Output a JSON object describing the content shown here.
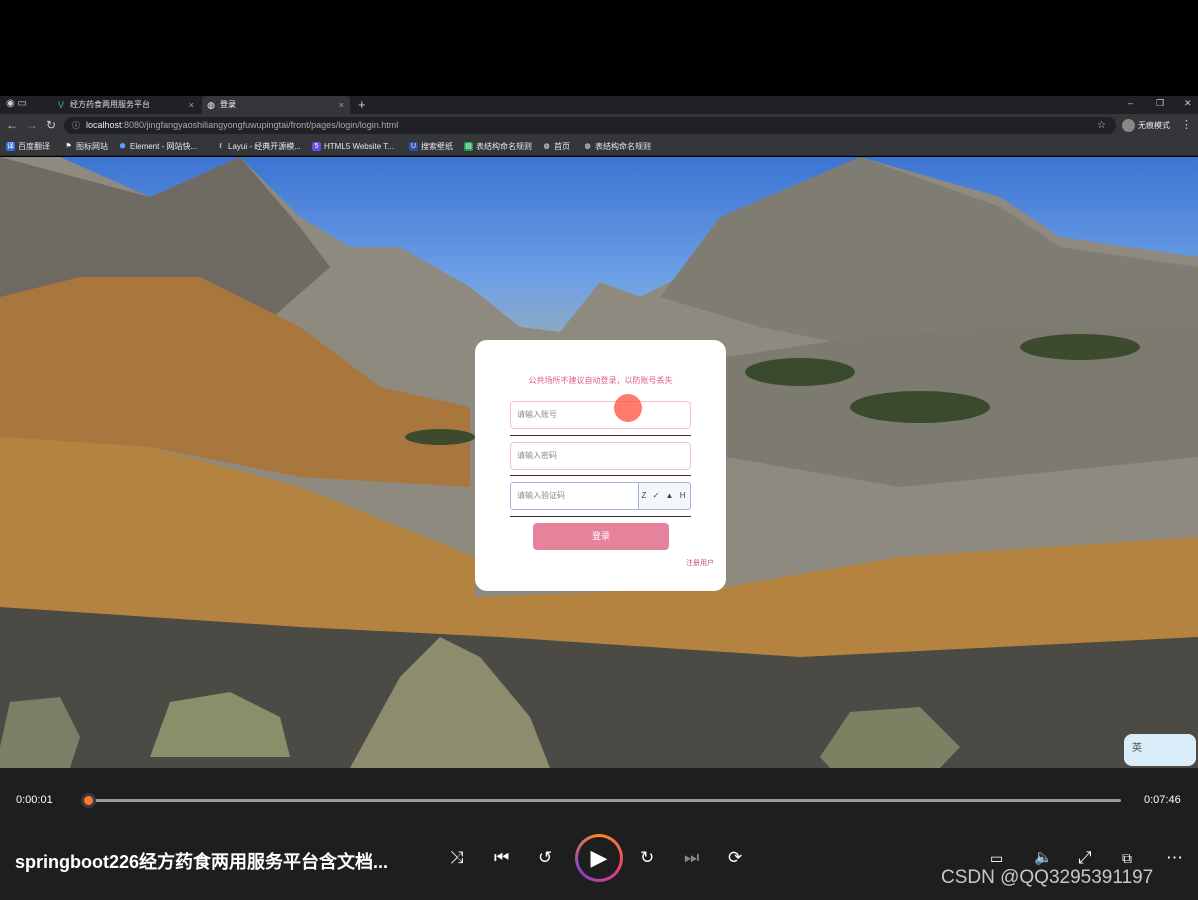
{
  "browser": {
    "tabs": [
      {
        "title": "经方药食两用服务平台",
        "icon": "vue-icon"
      },
      {
        "title": "登录",
        "icon": "globe-icon"
      }
    ],
    "new_tab": "+",
    "url_host": "localhost",
    "url_rest": ":8080/jingfangyaoshiliangyongfuwupingtai/front/pages/login/login.html",
    "profile_label": "无痕模式",
    "bookmarks": [
      "百度翻译",
      "图标网站",
      "Element - 网站快...",
      "Layui - 经典开源模...",
      "HTML5 Website T...",
      "搜索壁纸",
      "表结构命名规则",
      "首页",
      "表结构命名规则"
    ]
  },
  "login": {
    "notice": "公共场所不建议自动登录，以防账号丢失",
    "account_placeholder": "请输入账号",
    "password_placeholder": "请输入密码",
    "captcha_placeholder": "请输入验证码",
    "captcha_text": "Z ✓ ▲ H",
    "submit_label": "登录",
    "register_label": "注册用户"
  },
  "ime_label": "英",
  "player": {
    "current_time": "0:00:01",
    "duration": "0:07:46",
    "progress": 0.002,
    "title": "springboot226经方药食两用服务平台含文档...",
    "watermark": "CSDN @QQ3295391197"
  },
  "colors": {
    "accent_pink": "#e5829c",
    "progress_orange": "#ff7a30"
  }
}
